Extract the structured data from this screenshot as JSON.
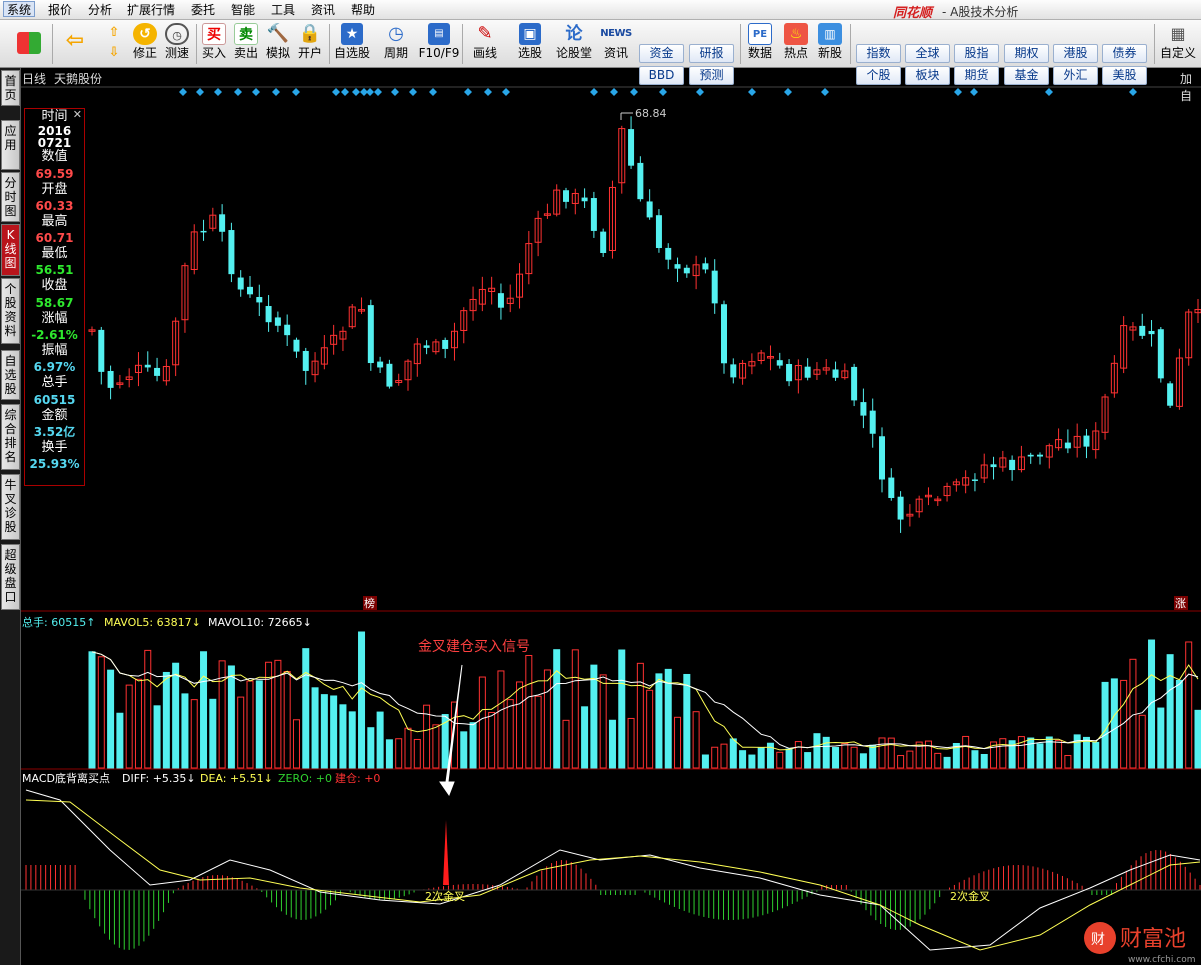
{
  "menubar": {
    "items": [
      "系统",
      "报价",
      "分析",
      "扩展行情",
      "委托",
      "智能",
      "工具",
      "资讯",
      "帮助"
    ],
    "brand": "同花顺",
    "title": "- A股技术分析"
  },
  "toolbar": {
    "buttons": [
      {
        "label": "",
        "icon": "grid-icon"
      },
      {
        "label": "",
        "icon": "back-arrow-icon"
      },
      {
        "label": "",
        "icon": "up-down-arrows-icon"
      },
      {
        "label": "修正",
        "icon": "revise-icon"
      },
      {
        "label": "测速",
        "icon": "clock-icon"
      },
      {
        "label": "买入",
        "icon": "buy-icon",
        "glyph": "买"
      },
      {
        "label": "卖出",
        "icon": "sell-icon",
        "glyph": "卖"
      },
      {
        "label": "模拟",
        "icon": "hammer-icon"
      },
      {
        "label": "开户",
        "icon": "lock-icon"
      },
      {
        "label": "自选股",
        "icon": "star-icon"
      },
      {
        "label": "周期",
        "icon": "cycle-icon"
      },
      {
        "label": "F10/F9",
        "icon": "f10-icon"
      },
      {
        "label": "画线",
        "icon": "pencil-icon"
      },
      {
        "label": "选股",
        "icon": "monitor-icon"
      },
      {
        "label": "论股堂",
        "icon": "forum-icon",
        "glyph": "论"
      },
      {
        "label": "资讯",
        "icon": "news-icon",
        "glyph": "NEWS"
      },
      {
        "label": "数据",
        "icon": "pe-icon",
        "glyph": "PE"
      },
      {
        "label": "热点",
        "icon": "hot-icon"
      },
      {
        "label": "新股",
        "icon": "newstock-icon"
      },
      {
        "label": "自定义",
        "icon": "custom-icon"
      }
    ],
    "small_buttons": [
      "资金",
      "研报",
      "BBD",
      "预测",
      "指数",
      "全球",
      "股指",
      "期权",
      "港股",
      "债券",
      "个股",
      "板块",
      "期货",
      "基金",
      "外汇",
      "美股"
    ]
  },
  "sidetabs": [
    "首页",
    "应用",
    "分时图",
    "K线图",
    "个股资料",
    "自选股",
    "综合排名",
    "牛叉诊股",
    "超级盘口"
  ],
  "chart_header": {
    "period": "日线",
    "stock": "天鹅股份",
    "add_label": "加自"
  },
  "infopanel": [
    {
      "label": "时间",
      "value": "2016\n0721",
      "color": "#ffffff"
    },
    {
      "label": "数值",
      "value": "69.59",
      "color": "#ff4a4a"
    },
    {
      "label": "开盘",
      "value": "60.33",
      "color": "#ff4a4a"
    },
    {
      "label": "最高",
      "value": "60.71",
      "color": "#ff4a4a"
    },
    {
      "label": "最低",
      "value": "56.51",
      "color": "#2ee82e"
    },
    {
      "label": "收盘",
      "value": "58.67",
      "color": "#2ee82e"
    },
    {
      "label": "涨幅",
      "value": "-2.61%",
      "color": "#2ee82e"
    },
    {
      "label": "振幅",
      "value": "6.97%",
      "color": "#55d7f0"
    },
    {
      "label": "总手",
      "value": "60515",
      "color": "#55d7f0"
    },
    {
      "label": "金额",
      "value": "3.52亿",
      "color": "#55d7f0"
    },
    {
      "label": "换手",
      "value": "25.93%",
      "color": "#55d7f0"
    }
  ],
  "price_panel": {
    "peak_label": "68.84",
    "tag_left": "榜",
    "tag_right": "涨"
  },
  "volume_panel": {
    "label_total": "总手: ",
    "total": "60515",
    "ma5_label": "MAVOL5: ",
    "ma5": "63817",
    "ma10_label": "MAVOL10: ",
    "ma10": "72665",
    "annotation": "金叉建仓买入信号"
  },
  "macd_panel": {
    "name": "MACD底背离买点",
    "diff_label": "DIFF: ",
    "diff": "+5.35",
    "dea_label": "DEA: ",
    "dea": "+5.51",
    "zero_label": "ZERO: ",
    "zero": "+0",
    "jc_label": "建仓: ",
    "jc": "+0",
    "cross_labels": [
      "2次金叉",
      "2次金叉"
    ]
  },
  "watermark": {
    "text": "财富池",
    "url": "www.cfchi.com"
  },
  "colors": {
    "up": "#ff3232",
    "down": "#54f0f0",
    "ma5": "#ffff55",
    "ma10": "#ffffff",
    "macd_up": "#ff3232",
    "macd_down": "#2fd02f"
  },
  "chart_data": [
    {
      "type": "candlestick",
      "title": "天鹅股份 日线",
      "peak_high": 68.84,
      "note": "daily OHLC series, approx. 120 bars, hover bar 2016-07-21"
    },
    {
      "type": "bar",
      "title": "总手",
      "series": [
        {
          "name": "MAVOL5"
        },
        {
          "name": "MAVOL10"
        }
      ]
    },
    {
      "type": "line",
      "title": "MACD底背离买点",
      "series": [
        {
          "name": "DIFF"
        },
        {
          "name": "DEA"
        }
      ]
    }
  ]
}
